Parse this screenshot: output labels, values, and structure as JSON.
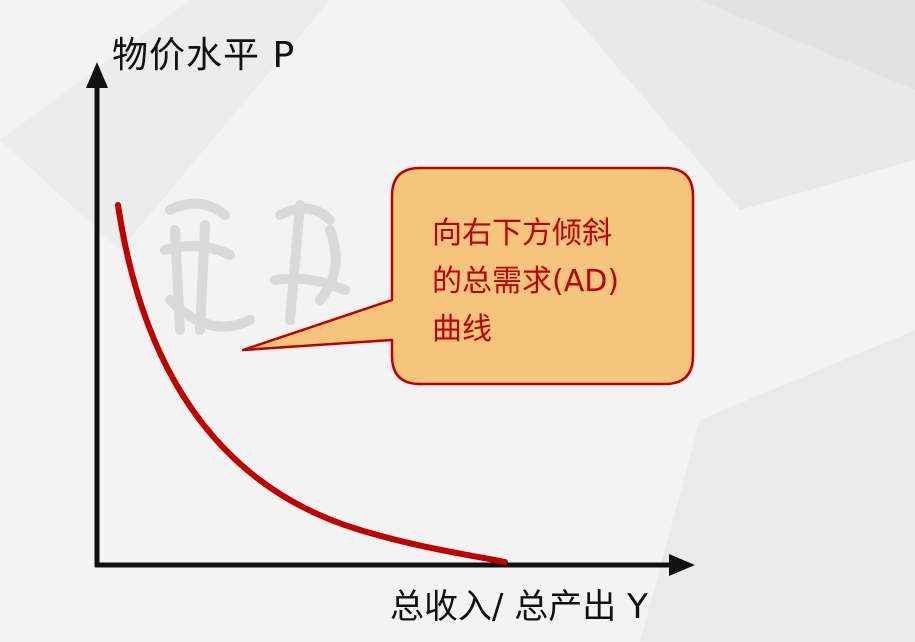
{
  "axes": {
    "y_label": "物价水平 P",
    "x_label": "总收入/ 总产出 Y"
  },
  "curve": {
    "color": "#c00000",
    "shape": "downward-sloping convex"
  },
  "callout": {
    "lines": [
      "向右下方倾斜",
      "的总需求(AD)",
      "曲线"
    ],
    "fill": "#f5c57c",
    "border": "#c00000",
    "text_color": "#c00000"
  },
  "colors": {
    "background": "#f3f3f3",
    "axis": "#111111"
  }
}
